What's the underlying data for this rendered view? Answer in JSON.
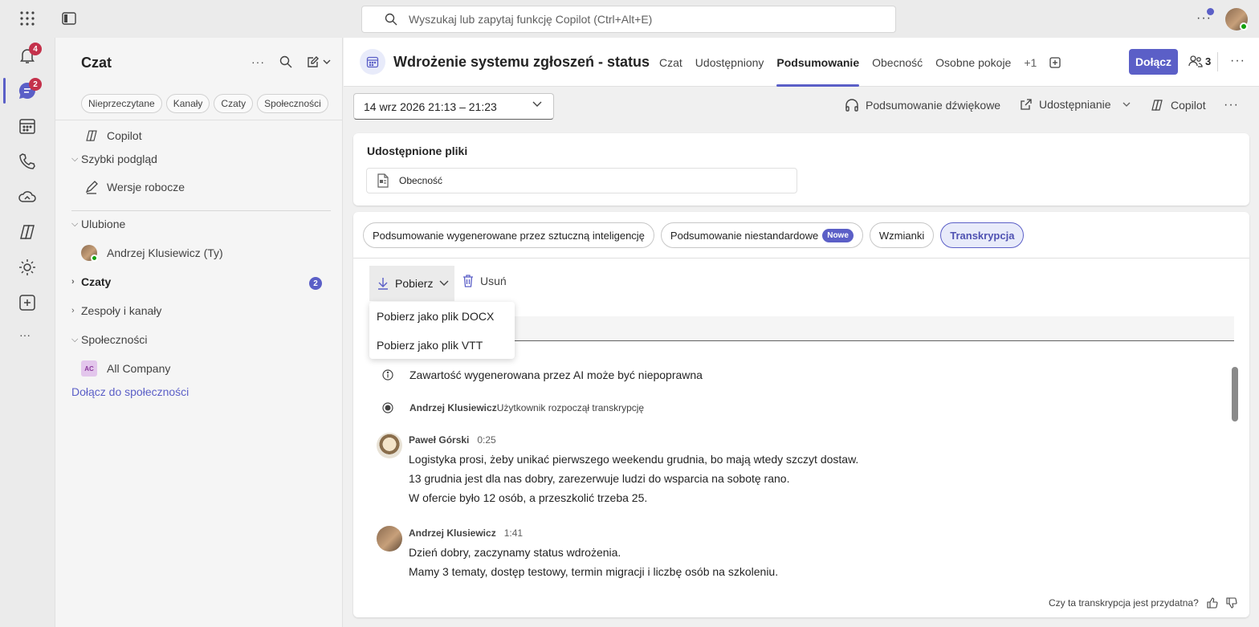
{
  "topbar": {
    "search_placeholder": "Wyszukaj lub zapytaj funkcję Copilot (Ctrl+Alt+E)",
    "more_label": "···"
  },
  "rail": {
    "activity_badge": "4",
    "chat_badge": "2",
    "more_label": "···"
  },
  "chat_panel": {
    "title": "Czat",
    "filters": [
      "Nieprzeczytane",
      "Kanały",
      "Czaty",
      "Społeczności"
    ],
    "copilot": "Copilot",
    "quick_view": "Szybki podgląd",
    "drafts": "Wersje robocze",
    "favorites": "Ulubione",
    "me": "Andrzej Klusiewicz (Ty)",
    "chats": "Czaty",
    "chats_count": "2",
    "teams": "Zespoły i kanały",
    "communities": "Społeczności",
    "community_initials": "AC",
    "community_name": "All Company",
    "join_community": "Dołącz do społeczności"
  },
  "meeting": {
    "title": "Wdrożenie systemu zgłoszeń - status",
    "tabs": [
      "Czat",
      "Udostępniony",
      "Podsumowanie",
      "Obecność",
      "Osobne pokoje",
      "+1"
    ],
    "active_tab": "Podsumowanie",
    "join_label": "Dołącz",
    "participants": "3"
  },
  "toolbar": {
    "date_range": "14 wrz 2026 21:13 – 21:23",
    "audio_summary": "Podsumowanie dźwiękowe",
    "sharing": "Udostępnianie",
    "copilot": "Copilot"
  },
  "shared_files": {
    "title": "Udostępnione pliki",
    "file_name": "Obecność"
  },
  "summary_tabs": {
    "ai_summary": "Podsumowanie wygenerowane przez sztuczną inteligencję",
    "custom_summary": "Podsumowanie niestandardowe",
    "new_badge": "Nowe",
    "mentions": "Wzmianki",
    "transcript": "Transkrypcja"
  },
  "transcript": {
    "download_label": "Pobierz",
    "delete_label": "Usuń",
    "menu": [
      "Pobierz jako plik DOCX",
      "Pobierz jako plik VTT"
    ],
    "ai_notice": "Zawartość wygenerowana przez AI może być niepoprawna",
    "system_speaker": "Andrzej Klusiewicz",
    "system_event": "Użytkownik rozpoczął transkrypcję",
    "entries": [
      {
        "speaker": "Paweł Górski",
        "time": "0:25",
        "lines": [
          "Logistyka prosi, żeby unikać pierwszego weekendu grudnia, bo mają wtedy szczyt dostaw.",
          "13 grudnia jest dla nas dobry, zarezerwuje ludzi do wsparcia na sobotę rano.",
          "W ofercie było 12 osób, a przeszkolić trzeba 25."
        ]
      },
      {
        "speaker": "Andrzej Klusiewicz",
        "time": "1:41",
        "lines": [
          "Dzień dobry, zaczynamy status wdrożenia.",
          "Mamy 3 tematy, dostęp testowy, termin migracji i liczbę osób na szkoleniu."
        ]
      }
    ],
    "feedback_question": "Czy ta transkrypcja jest przydatna?"
  },
  "colors": {
    "accent": "#5b5fc7",
    "badge_red": "#c4314b",
    "presence_green": "#13a10e"
  }
}
